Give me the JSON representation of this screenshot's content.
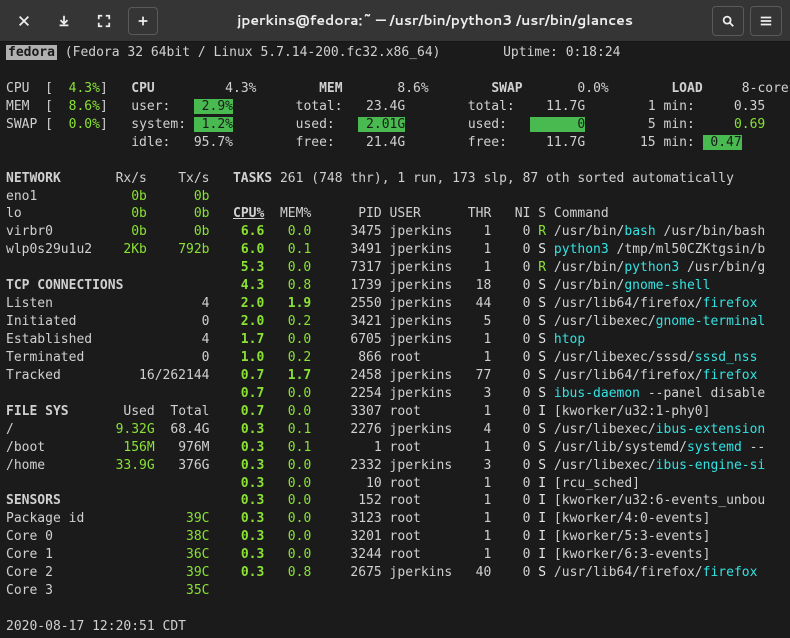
{
  "titlebar": {
    "title": "jperkins@fedora:~ — /usr/bin/python3 /usr/bin/glances"
  },
  "header": {
    "host": "fedora",
    "osline": "(Fedora 32 64bit / Linux 5.7.14-200.fc32.x86_64)",
    "uptime_label": "Uptime:",
    "uptime": "0:18:24"
  },
  "summary": {
    "cpu": {
      "label": "CPU",
      "val": "4.3%"
    },
    "mem": {
      "label": "MEM",
      "val": "8.6%"
    },
    "swap": {
      "label": "SWAP",
      "val": "0.0%"
    },
    "cpu_detail": {
      "label": "CPU",
      "val": "4.3%",
      "user_l": "user:",
      "user": "2.9%",
      "system_l": "system:",
      "system": "1.2%",
      "idle_l": "idle:",
      "idle": "95.7%"
    },
    "mem_detail": {
      "label": "MEM",
      "val": "8.6%",
      "total_l": "total:",
      "total": "23.4G",
      "used_l": "used:",
      "used": "2.01G",
      "free_l": "free:",
      "free": "21.4G"
    },
    "swap_detail": {
      "label": "SWAP",
      "val": "0.0%",
      "total_l": "total:",
      "total": "11.7G",
      "used_l": "used:",
      "used": "0",
      "free_l": "free:",
      "free": "11.7G"
    },
    "load": {
      "label": "LOAD",
      "cores": "8-core",
      "l1_l": "1 min:",
      "l1": "0.35",
      "l5_l": "5 min:",
      "l5": "0.69",
      "l15_l": "15 min:",
      "l15": "0.47"
    }
  },
  "network": {
    "title": "NETWORK",
    "rx": "Rx/s",
    "tx": "Tx/s",
    "rows": [
      {
        "n": "eno1",
        "rx": "0b",
        "tx": "0b"
      },
      {
        "n": "lo",
        "rx": "0b",
        "tx": "0b"
      },
      {
        "n": "virbr0",
        "rx": "0b",
        "tx": "0b"
      },
      {
        "n": "wlp0s29u1u2",
        "rx": "2Kb",
        "tx": "792b"
      }
    ]
  },
  "tcp": {
    "title": "TCP CONNECTIONS",
    "rows": [
      {
        "n": "Listen",
        "v": "4"
      },
      {
        "n": "Initiated",
        "v": "0"
      },
      {
        "n": "Established",
        "v": "4"
      },
      {
        "n": "Terminated",
        "v": "0"
      },
      {
        "n": "Tracked",
        "v": "16/262144"
      }
    ]
  },
  "fs": {
    "title": "FILE SYS",
    "used": "Used",
    "total": "Total",
    "rows": [
      {
        "n": "/",
        "u": "9.32G",
        "t": "68.4G"
      },
      {
        "n": "/boot",
        "u": "156M",
        "t": "976M"
      },
      {
        "n": "/home",
        "u": "33.9G",
        "t": "376G"
      }
    ]
  },
  "sensors": {
    "title": "SENSORS",
    "rows": [
      {
        "n": "Package id",
        "v": "39C"
      },
      {
        "n": "Core 0",
        "v": "38C"
      },
      {
        "n": "Core 1",
        "v": "36C"
      },
      {
        "n": "Core 2",
        "v": "39C"
      },
      {
        "n": "Core 3",
        "v": "35C"
      }
    ]
  },
  "tasks": {
    "label": "TASKS",
    "text": "261 (748 thr), 1 run, 173 slp, 87 oth sorted automatically"
  },
  "proc_header": {
    "cpu": "CPU%",
    "mem": "MEM%",
    "pid": "PID",
    "user": "USER",
    "thr": "THR",
    "ni": "NI",
    "s": "S",
    "cmd": "Command"
  },
  "procs": [
    {
      "cpu": "6.6",
      "mem": "0.0",
      "pid": "3475",
      "user": "jperkins",
      "thr": "1",
      "ni": "0",
      "s": "R",
      "cmd_pre": "/usr/bin/",
      "cmd_hl": "bash",
      "cmd_post": " /usr/bin/bash"
    },
    {
      "cpu": "6.0",
      "mem": "0.1",
      "pid": "3491",
      "user": "jperkins",
      "thr": "1",
      "ni": "0",
      "s": "S",
      "cmd_pre": "",
      "cmd_hl": "python3",
      "cmd_post": " /tmp/ml50CZKtgsin/b"
    },
    {
      "cpu": "5.3",
      "mem": "0.0",
      "pid": "7317",
      "user": "jperkins",
      "thr": "1",
      "ni": "0",
      "s": "R",
      "cmd_pre": "/usr/bin/",
      "cmd_hl": "python3",
      "cmd_post": " /usr/bin/g"
    },
    {
      "cpu": "4.3",
      "mem": "0.8",
      "pid": "1739",
      "user": "jperkins",
      "thr": "18",
      "ni": "0",
      "s": "S",
      "cmd_pre": "/usr/bin/",
      "cmd_hl": "gnome-shell",
      "cmd_post": ""
    },
    {
      "cpu": "2.0",
      "mem": "1.9",
      "pid": "2550",
      "user": "jperkins",
      "thr": "44",
      "ni": "0",
      "s": "S",
      "cmd_pre": "/usr/lib64/firefox/",
      "cmd_hl": "firefox",
      "cmd_post": ""
    },
    {
      "cpu": "2.0",
      "mem": "0.2",
      "pid": "3421",
      "user": "jperkins",
      "thr": "5",
      "ni": "0",
      "s": "S",
      "cmd_pre": "/usr/libexec/",
      "cmd_hl": "gnome-terminal",
      "cmd_post": ""
    },
    {
      "cpu": "1.7",
      "mem": "0.0",
      "pid": "6705",
      "user": "jperkins",
      "thr": "1",
      "ni": "0",
      "s": "S",
      "cmd_pre": "",
      "cmd_hl": "htop",
      "cmd_post": ""
    },
    {
      "cpu": "1.0",
      "mem": "0.2",
      "pid": "866",
      "user": "root",
      "thr": "1",
      "ni": "0",
      "s": "S",
      "cmd_pre": "/usr/libexec/sssd/",
      "cmd_hl": "sssd_nss",
      "cmd_post": ""
    },
    {
      "cpu": "0.7",
      "mem": "1.7",
      "pid": "2458",
      "user": "jperkins",
      "thr": "77",
      "ni": "0",
      "s": "S",
      "cmd_pre": "/usr/lib64/firefox/",
      "cmd_hl": "firefox",
      "cmd_post": ""
    },
    {
      "cpu": "0.7",
      "mem": "0.0",
      "pid": "2254",
      "user": "jperkins",
      "thr": "3",
      "ni": "0",
      "s": "S",
      "cmd_pre": "",
      "cmd_hl": "ibus-daemon",
      "cmd_post": " --panel disable"
    },
    {
      "cpu": "0.7",
      "mem": "0.0",
      "pid": "3307",
      "user": "root",
      "thr": "1",
      "ni": "0",
      "s": "I",
      "cmd_pre": "[kworker/u32:1-phy0]",
      "cmd_hl": "",
      "cmd_post": ""
    },
    {
      "cpu": "0.3",
      "mem": "0.1",
      "pid": "2276",
      "user": "jperkins",
      "thr": "4",
      "ni": "0",
      "s": "S",
      "cmd_pre": "/usr/libexec/",
      "cmd_hl": "ibus-extension",
      "cmd_post": ""
    },
    {
      "cpu": "0.3",
      "mem": "0.1",
      "pid": "1",
      "user": "root",
      "thr": "1",
      "ni": "0",
      "s": "S",
      "cmd_pre": "/usr/lib/systemd/",
      "cmd_hl": "systemd",
      "cmd_post": " --"
    },
    {
      "cpu": "0.3",
      "mem": "0.0",
      "pid": "2332",
      "user": "jperkins",
      "thr": "3",
      "ni": "0",
      "s": "S",
      "cmd_pre": "/usr/libexec/",
      "cmd_hl": "ibus-engine-si",
      "cmd_post": ""
    },
    {
      "cpu": "0.3",
      "mem": "0.0",
      "pid": "10",
      "user": "root",
      "thr": "1",
      "ni": "0",
      "s": "I",
      "cmd_pre": "[rcu_sched]",
      "cmd_hl": "",
      "cmd_post": ""
    },
    {
      "cpu": "0.3",
      "mem": "0.0",
      "pid": "152",
      "user": "root",
      "thr": "1",
      "ni": "0",
      "s": "I",
      "cmd_pre": "[kworker/u32:6-events_unbou",
      "cmd_hl": "",
      "cmd_post": ""
    },
    {
      "cpu": "0.3",
      "mem": "0.0",
      "pid": "3123",
      "user": "root",
      "thr": "1",
      "ni": "0",
      "s": "I",
      "cmd_pre": "[kworker/4:0-events]",
      "cmd_hl": "",
      "cmd_post": ""
    },
    {
      "cpu": "0.3",
      "mem": "0.0",
      "pid": "3201",
      "user": "root",
      "thr": "1",
      "ni": "0",
      "s": "I",
      "cmd_pre": "[kworker/5:3-events]",
      "cmd_hl": "",
      "cmd_post": ""
    },
    {
      "cpu": "0.3",
      "mem": "0.0",
      "pid": "3244",
      "user": "root",
      "thr": "1",
      "ni": "0",
      "s": "I",
      "cmd_pre": "[kworker/6:3-events]",
      "cmd_hl": "",
      "cmd_post": ""
    },
    {
      "cpu": "0.3",
      "mem": "0.8",
      "pid": "2675",
      "user": "jperkins",
      "thr": "40",
      "ni": "0",
      "s": "S",
      "cmd_pre": "/usr/lib64/firefox/",
      "cmd_hl": "firefox",
      "cmd_post": ""
    }
  ],
  "footer": "2020-08-17 12:20:51 CDT"
}
